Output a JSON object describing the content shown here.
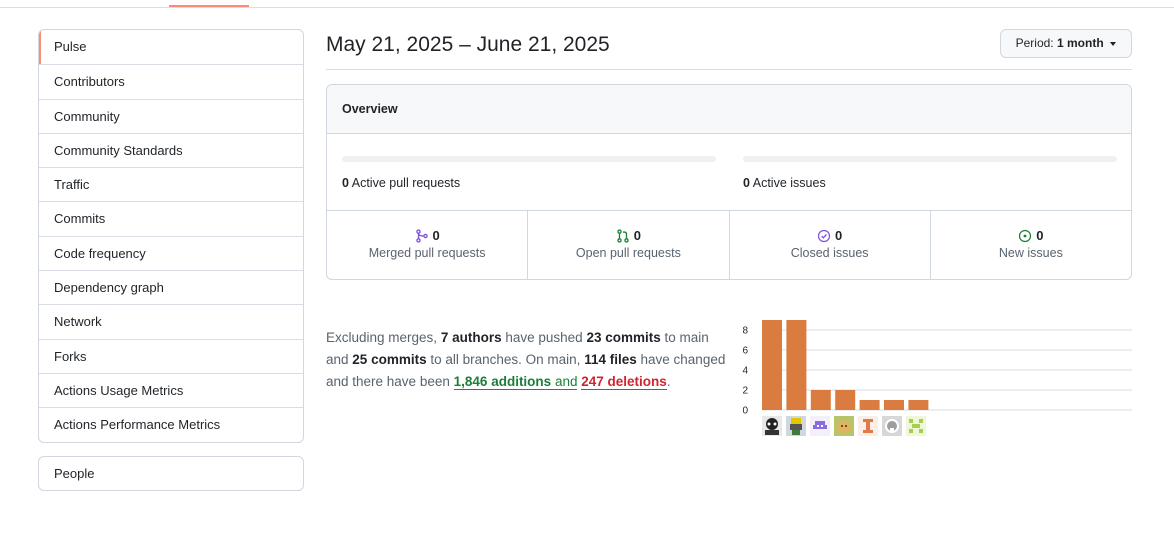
{
  "sidebar": {
    "items": [
      {
        "label": "Pulse",
        "selected": true
      },
      {
        "label": "Contributors"
      },
      {
        "label": "Community"
      },
      {
        "label": "Community Standards"
      },
      {
        "label": "Traffic"
      },
      {
        "label": "Commits"
      },
      {
        "label": "Code frequency"
      },
      {
        "label": "Dependency graph"
      },
      {
        "label": "Network"
      },
      {
        "label": "Forks"
      },
      {
        "label": "Actions Usage Metrics"
      },
      {
        "label": "Actions Performance Metrics"
      }
    ],
    "people_label": "People"
  },
  "header": {
    "date_range": "May 21, 2025 – June 21, 2025",
    "period_prefix": "Period:",
    "period_value": "1 month"
  },
  "overview": {
    "title": "Overview",
    "active_prs_count": "0",
    "active_prs_label": "Active pull requests",
    "active_issues_count": "0",
    "active_issues_label": "Active issues",
    "stats": [
      {
        "count": "0",
        "label": "Merged pull requests",
        "icon": "merged-pr-icon",
        "color": "#8250df"
      },
      {
        "count": "0",
        "label": "Open pull requests",
        "icon": "open-pr-icon",
        "color": "#1a7f37"
      },
      {
        "count": "0",
        "label": "Closed issues",
        "icon": "closed-issue-icon",
        "color": "#8250df"
      },
      {
        "count": "0",
        "label": "New issues",
        "icon": "new-issue-icon",
        "color": "#1a7f37"
      }
    ]
  },
  "summary": {
    "t1": "Excluding merges,",
    "authors": "7 authors",
    "t2": "have pushed",
    "commits_main": "23 commits",
    "t3": "to main and",
    "commits_all": "25 commits",
    "t4": "to all branches. On main,",
    "files": "114 files",
    "t5": "have changed and there have been",
    "additions": "1,846",
    "additions_word": "additions",
    "t6": "and",
    "deletions": "247",
    "deletions_word": "deletions",
    "t7": "."
  },
  "chart_data": {
    "type": "bar",
    "categories": [
      "author-1",
      "author-2",
      "author-3",
      "author-4",
      "author-5",
      "author-6",
      "author-7"
    ],
    "values": [
      9,
      9,
      2,
      2,
      1,
      1,
      1
    ],
    "yticks": [
      "0",
      "2",
      "4",
      "6",
      "8"
    ],
    "ylim": [
      0,
      9
    ],
    "bar_color": "#da7b3f",
    "grid": true
  },
  "colors": {
    "accent_underline": "#fd8c73",
    "addition": "#1a7f37",
    "deletion": "#d1242f"
  }
}
